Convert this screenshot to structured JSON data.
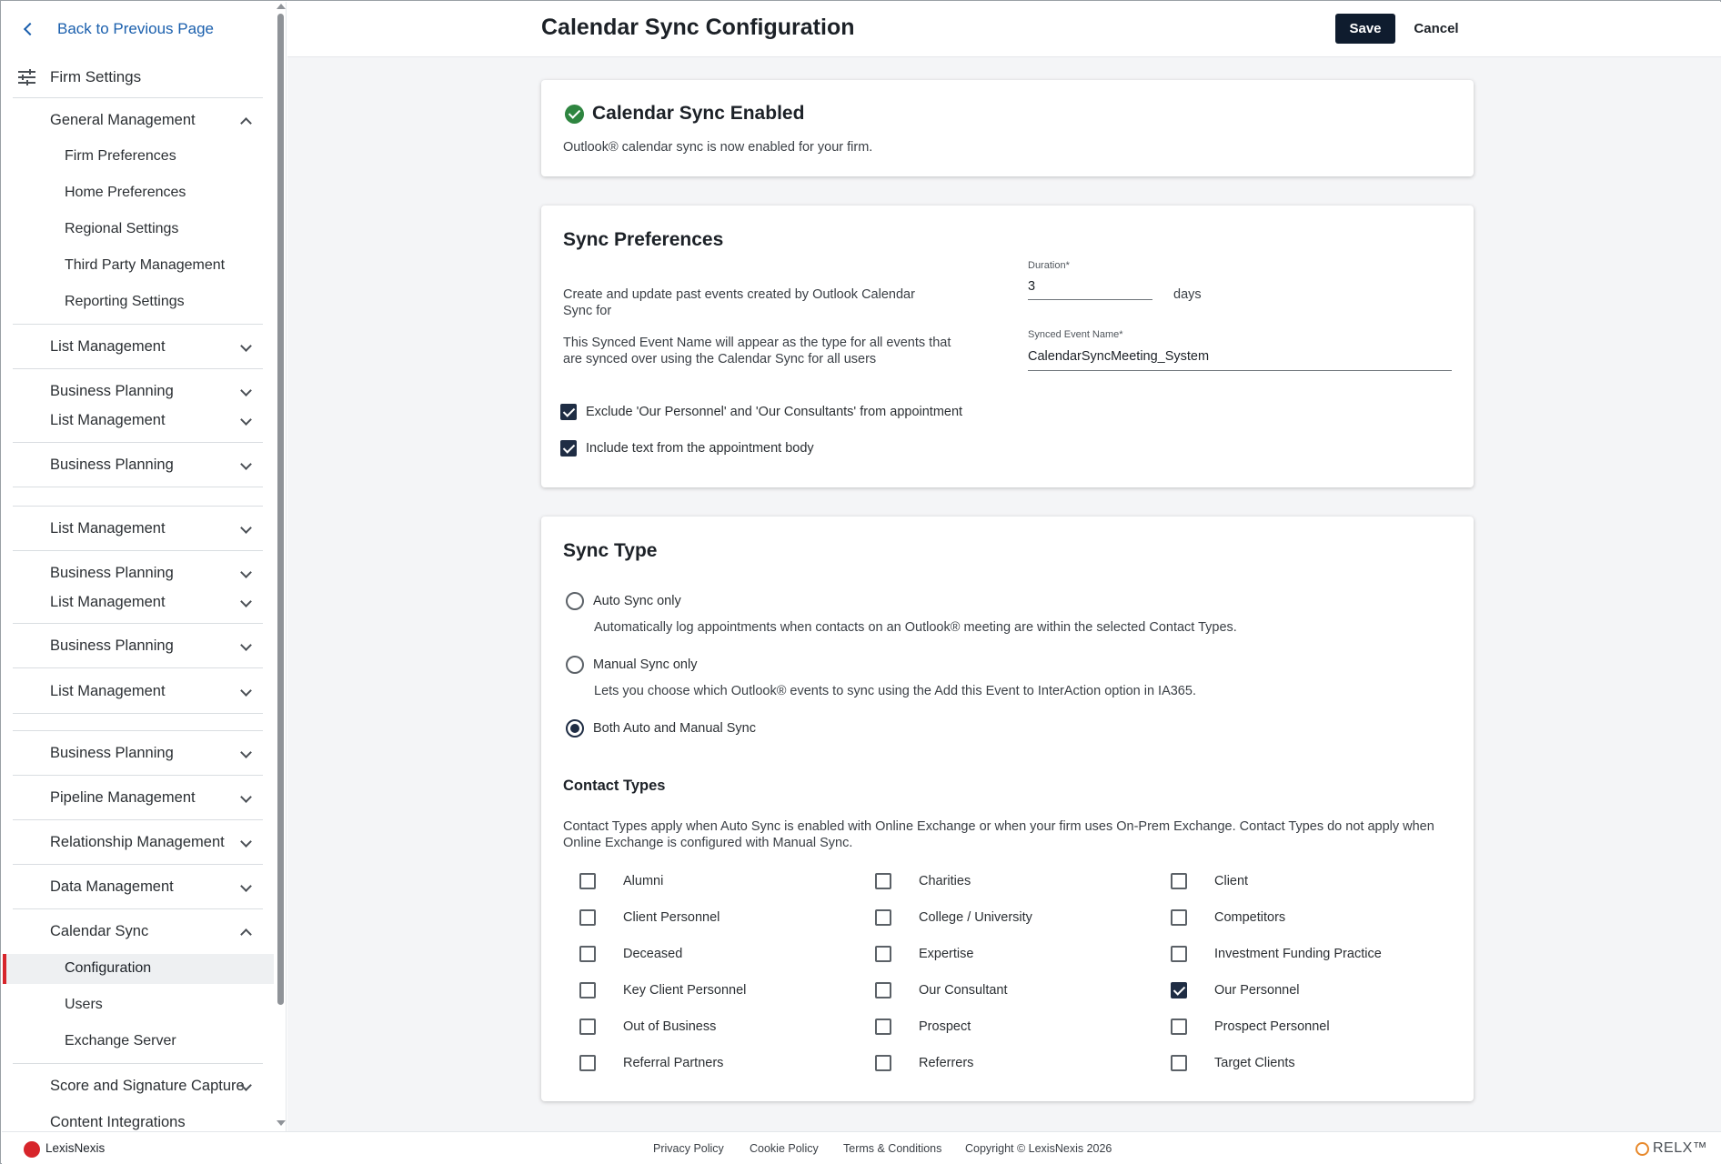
{
  "sidebar": {
    "back_label": "Back to Previous Page",
    "firm_settings": "Firm Settings",
    "general_management": "General Management",
    "general_items": [
      "Firm Preferences",
      "Home Preferences",
      "Regional Settings",
      "Third Party Management",
      "Reporting Settings"
    ],
    "list_management": "List Management",
    "business_planning": "Business Planning",
    "pipeline_management": "Pipeline Management",
    "relationship_management": "Relationship Management",
    "data_management": "Data Management",
    "calendar_sync": "Calendar Sync",
    "calendar_items": [
      "Configuration",
      "Users",
      "Exchange Server"
    ],
    "score_signature": "Score and Signature Capture",
    "content_integrations": "Content Integrations"
  },
  "header": {
    "title": "Calendar Sync Configuration",
    "save_label": "Save",
    "cancel_label": "Cancel"
  },
  "enabled_card": {
    "title": "Calendar Sync Enabled",
    "text": "Outlook® calendar sync is now enabled for your firm."
  },
  "preferences": {
    "title": "Sync Preferences",
    "past_events_text": "Create and update past events created by Outlook Calendar Sync for",
    "duration_label": "Duration*",
    "duration_value": "3",
    "duration_unit": "days",
    "event_name_text": "This Synced Event Name will appear as the type for all events that are synced over using the Calendar Sync for all users",
    "event_name_label": "Synced Event Name*",
    "event_name_value": "CalendarSyncMeeting_System",
    "exclude_label": "Exclude 'Our Personnel' and 'Our Consultants' from appointment",
    "exclude_checked": true,
    "include_label": "Include text from the appointment body",
    "include_checked": true
  },
  "sync_type": {
    "title": "Sync Type",
    "options": [
      {
        "label": "Auto Sync only",
        "description": "Automatically log appointments when contacts on an Outlook® meeting are within the selected Contact Types.",
        "selected": false
      },
      {
        "label": "Manual Sync only",
        "description": "Lets you choose which Outlook® events to sync using the Add this Event to InterAction option in IA365.",
        "selected": false
      },
      {
        "label": "Both Auto and Manual Sync",
        "description": "",
        "selected": true
      }
    ],
    "contact_types_title": "Contact Types",
    "contact_types_text": "Contact Types apply when Auto Sync is enabled with Online Exchange or when your firm uses On-Prem Exchange. Contact Types do not apply when Online Exchange is configured with Manual Sync.",
    "contact_types": [
      {
        "label": "Alumni",
        "checked": false
      },
      {
        "label": "Charities",
        "checked": false
      },
      {
        "label": "Client",
        "checked": false
      },
      {
        "label": "Client Personnel",
        "checked": false
      },
      {
        "label": "College / University",
        "checked": false
      },
      {
        "label": "Competitors",
        "checked": false
      },
      {
        "label": "Deceased",
        "checked": false
      },
      {
        "label": "Expertise",
        "checked": false
      },
      {
        "label": "Investment Funding Practice",
        "checked": false
      },
      {
        "label": "Key Client Personnel",
        "checked": false
      },
      {
        "label": "Our Consultant",
        "checked": false
      },
      {
        "label": "Our Personnel",
        "checked": true
      },
      {
        "label": "Out of Business",
        "checked": false
      },
      {
        "label": "Prospect",
        "checked": false
      },
      {
        "label": "Prospect Personnel",
        "checked": false
      },
      {
        "label": "Referral Partners",
        "checked": false
      },
      {
        "label": "Referrers",
        "checked": false
      },
      {
        "label": "Target Clients",
        "checked": false
      }
    ]
  },
  "footer": {
    "brand": "LexisNexis",
    "links": [
      "Privacy Policy",
      "Cookie Policy",
      "Terms & Conditions",
      "Copyright © LexisNexis 2026"
    ],
    "relx": "RELX™"
  },
  "colors": {
    "accent": "#0f1c2e",
    "link": "#1a5fad",
    "selected_marker": "#d7252b",
    "success": "#2e8540"
  }
}
